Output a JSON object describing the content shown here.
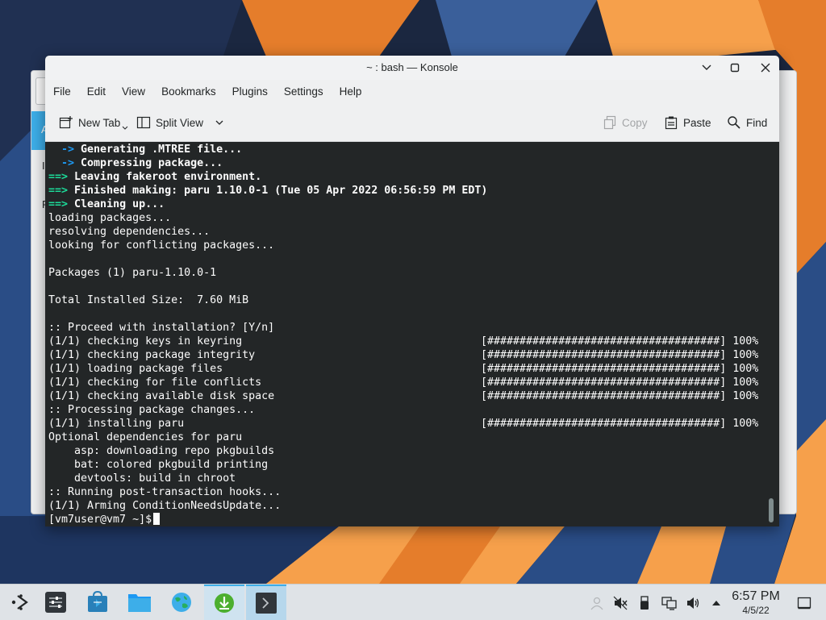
{
  "desktop": {
    "wallpaper_colors": {
      "sky": "#1b2740",
      "orange": "#f6a04b",
      "deep_orange": "#e57d2b",
      "blue": "#2a4d86"
    }
  },
  "background_window": {
    "letters": [
      "I",
      "F"
    ]
  },
  "konsole": {
    "title": "~ : bash — Konsole",
    "menu": [
      "File",
      "Edit",
      "View",
      "Bookmarks",
      "Plugins",
      "Settings",
      "Help"
    ],
    "toolbar": {
      "new_tab": "New Tab",
      "split_view": "Split View",
      "copy": "Copy",
      "paste": "Paste",
      "find": "Find"
    },
    "terminal": {
      "lines": [
        {
          "prefix": "  ->",
          "prefix_color": "blue",
          "text": " Generating .MTREE file...",
          "bold": true
        },
        {
          "prefix": "  ->",
          "prefix_color": "blue",
          "text": " Compressing package...",
          "bold": true
        },
        {
          "prefix": "==>",
          "prefix_color": "green",
          "text": " Leaving fakeroot environment.",
          "bold": true
        },
        {
          "prefix": "==>",
          "prefix_color": "green",
          "text": " Finished making: paru 1.10.0-1 (Tue 05 Apr 2022 06:56:59 PM EDT)",
          "bold": true
        },
        {
          "prefix": "==>",
          "prefix_color": "green",
          "text": " Cleaning up...",
          "bold": true
        },
        {
          "text": "loading packages..."
        },
        {
          "text": "resolving dependencies..."
        },
        {
          "text": "looking for conflicting packages..."
        },
        {
          "text": ""
        },
        {
          "text": "Packages (1) paru-1.10.0-1"
        },
        {
          "text": ""
        },
        {
          "text": "Total Installed Size:  7.60 MiB"
        },
        {
          "text": ""
        },
        {
          "text": ":: Proceed with installation? [Y/n]"
        },
        {
          "text": "(1/1) checking keys in keyring",
          "bar": "[####################################] 100%"
        },
        {
          "text": "(1/1) checking package integrity",
          "bar": "[####################################] 100%"
        },
        {
          "text": "(1/1) loading package files",
          "bar": "[####################################] 100%"
        },
        {
          "text": "(1/1) checking for file conflicts",
          "bar": "[####################################] 100%"
        },
        {
          "text": "(1/1) checking available disk space",
          "bar": "[####################################] 100%"
        },
        {
          "text": ":: Processing package changes..."
        },
        {
          "text": "(1/1) installing paru",
          "bar": "[####################################] 100%"
        },
        {
          "text": "Optional dependencies for paru"
        },
        {
          "text": "    asp: downloading repo pkgbuilds"
        },
        {
          "text": "    bat: colored pkgbuild printing"
        },
        {
          "text": "    devtools: build in chroot"
        },
        {
          "text": ":: Running post-transaction hooks..."
        },
        {
          "text": "(1/1) Arming ConditionNeedsUpdate..."
        }
      ],
      "prompt": "[vm7user@vm7 ~]$"
    }
  },
  "taskbar": {
    "apps": [
      "application-launcher-icon",
      "system-settings-icon",
      "discover-store-icon",
      "file-manager-icon",
      "web-browser-icon",
      "download-manager-icon",
      "konsole-icon"
    ],
    "tray": [
      "user-icon",
      "volume-muted-icon",
      "usb-device-icon",
      "network-icon",
      "speaker-icon",
      "show-hidden-icons-arrow"
    ],
    "clock": {
      "time": "6:57 PM",
      "date": "4/5/22"
    }
  }
}
